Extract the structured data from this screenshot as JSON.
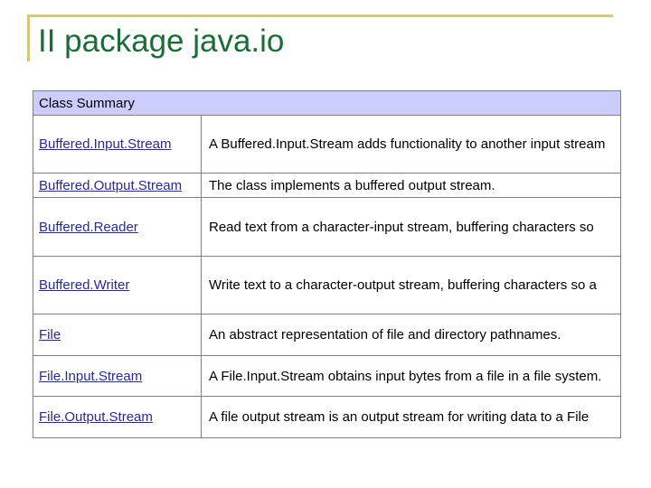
{
  "slide": {
    "title": "II package java.io"
  },
  "table": {
    "header": "Class Summary",
    "rows": [
      {
        "name": "Buffered.Input.Stream",
        "desc": "A Buffered.Input.Stream adds functionality to another input stream"
      },
      {
        "name": "Buffered.Output.Stream",
        "desc": "The class implements a buffered output stream."
      },
      {
        "name": "Buffered.Reader",
        "desc": "Read text from a character-input stream, buffering characters so"
      },
      {
        "name": "Buffered.Writer",
        "desc": "Write text to a character-output stream, buffering characters so a"
      },
      {
        "name": "File",
        "desc": "An abstract representation of file and directory pathnames."
      },
      {
        "name": "File.Input.Stream",
        "desc": "A File.Input.Stream obtains input bytes from a file in a file system."
      },
      {
        "name": "File.Output.Stream",
        "desc": "A file output stream is an output stream for writing data to a File"
      }
    ]
  }
}
